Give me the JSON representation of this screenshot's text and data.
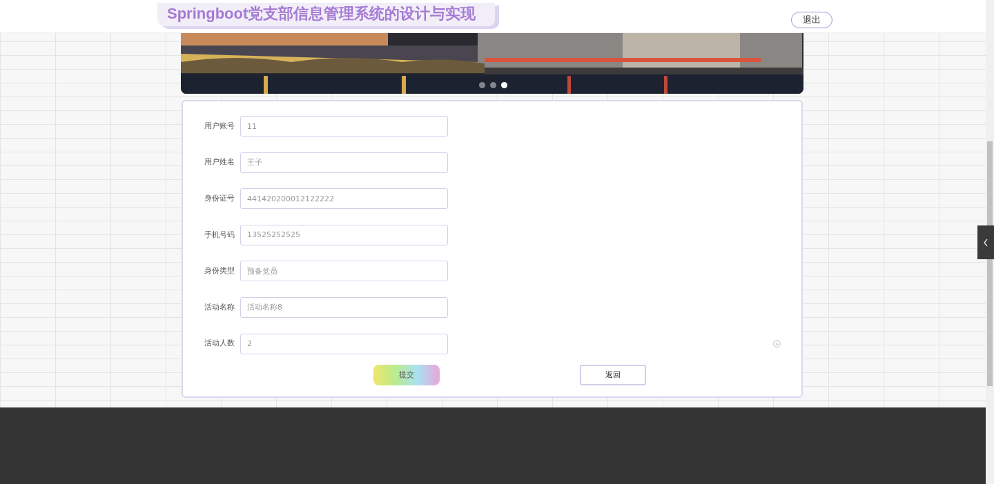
{
  "header": {
    "title": "Springboot党支部信息管理系统的设计与实现",
    "logout": "退出"
  },
  "banner": {
    "kind": "picture",
    "dots": [
      {
        "selected": false
      },
      {
        "selected": false
      },
      {
        "selected": true
      }
    ]
  },
  "form": {
    "fields": [
      {
        "label": "用户账号",
        "value": "11"
      },
      {
        "label": "用户姓名",
        "value": "王子"
      },
      {
        "label": "身份证号",
        "value": "441420200012122222"
      },
      {
        "label": "手机号码",
        "value": "13525252525"
      },
      {
        "label": "身份类型",
        "value": "预备党员"
      },
      {
        "label": "活动名称",
        "value": "活动名称8"
      },
      {
        "label": "活动人数",
        "value": "2"
      }
    ],
    "buttons": [
      {
        "label": "提交",
        "kind": "primary"
      },
      {
        "label": "返回",
        "kind": "secondary"
      }
    ]
  }
}
